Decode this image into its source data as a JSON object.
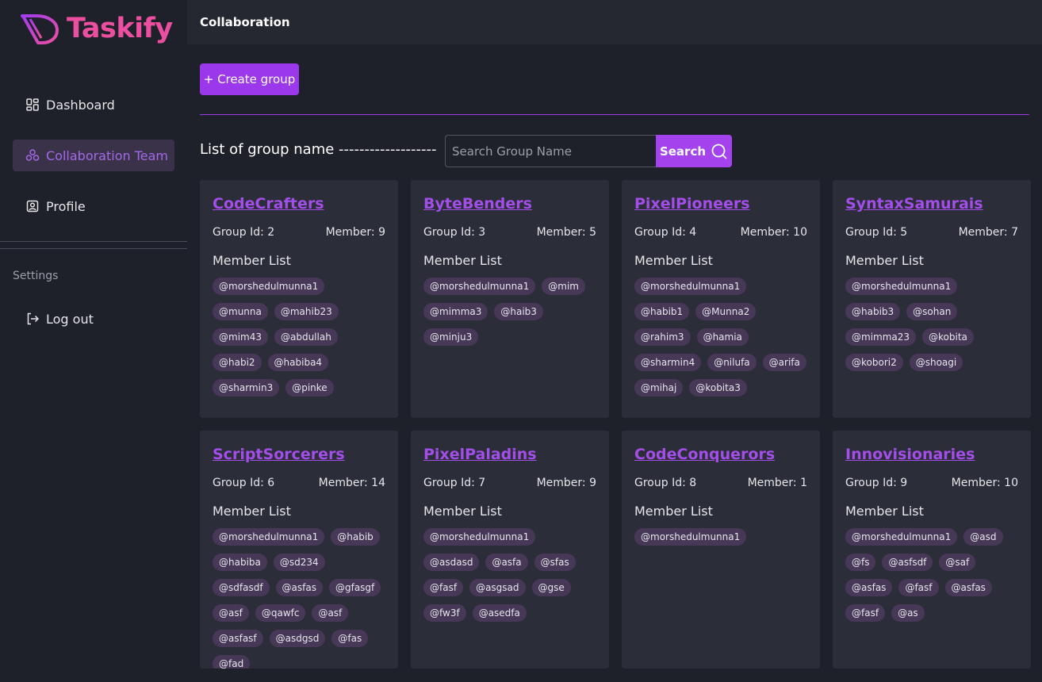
{
  "brand": {
    "name": "Taskify",
    "color": "#ec4fa0",
    "accent": "#9b38ec"
  },
  "sidebar": {
    "items": [
      {
        "label": "Dashboard",
        "icon": "dashboard-icon"
      },
      {
        "label": "Collaboration Team",
        "icon": "team-icon",
        "active": true
      },
      {
        "label": "Profile",
        "icon": "profile-icon"
      }
    ],
    "settings_label": "Settings",
    "logout_label": "Log out"
  },
  "header": {
    "title": "Collaboration"
  },
  "toolbar": {
    "create_label": "+ Create group"
  },
  "list": {
    "title": "List of group name -------------------",
    "search_placeholder": "Search Group Name",
    "search_label": "Search"
  },
  "groups": [
    {
      "name": "CodeCrafters",
      "id_text": "Group Id: 2",
      "member_text": "Member: 9",
      "member_list_label": "Member List",
      "members": [
        "@morshedulmunna1",
        "@munna",
        "@mahib23",
        "@mim43",
        "@abdullah",
        "@habi2",
        "@habiba4",
        "@sharmin3",
        "@pinke"
      ]
    },
    {
      "name": "ByteBenders",
      "id_text": "Group Id: 3",
      "member_text": "Member: 5",
      "member_list_label": "Member List",
      "members": [
        "@morshedulmunna1",
        "@mim",
        "@mimma3",
        "@haib3",
        "@minju3"
      ]
    },
    {
      "name": "PixelPioneers",
      "id_text": "Group Id: 4",
      "member_text": "Member: 10",
      "member_list_label": "Member List",
      "members": [
        "@morshedulmunna1",
        "@habib1",
        "@Munna2",
        "@rahim3",
        "@hamia",
        "@sharmin4",
        "@nilufa",
        "@arifa",
        "@mihaj",
        "@kobita3"
      ]
    },
    {
      "name": "SyntaxSamurais",
      "id_text": "Group Id: 5",
      "member_text": "Member: 7",
      "member_list_label": "Member List",
      "members": [
        "@morshedulmunna1",
        "@habib3",
        "@sohan",
        "@mimma23",
        "@kobita",
        "@kobori2",
        "@shoagi"
      ]
    },
    {
      "name": "ScriptSorcerers",
      "id_text": "Group Id: 6",
      "member_text": "Member: 14",
      "member_list_label": "Member List",
      "members": [
        "@morshedulmunna1",
        "@habib",
        "@habiba",
        "@sd234",
        "@sdfasdf",
        "@asfas",
        "@gfasgf",
        "@asf",
        "@qawfc",
        "@asf",
        "@asfasf",
        "@asdgsd",
        "@fas",
        "@fad"
      ]
    },
    {
      "name": "PixelPaladins",
      "id_text": "Group Id: 7",
      "member_text": "Member: 9",
      "member_list_label": "Member List",
      "members": [
        "@morshedulmunna1",
        "@asdasd",
        "@asfa",
        "@sfas",
        "@fasf",
        "@asgsad",
        "@gse",
        "@fw3f",
        "@asedfa"
      ]
    },
    {
      "name": "CodeConquerors",
      "id_text": "Group Id: 8",
      "member_text": "Member: 1",
      "member_list_label": "Member List",
      "members": [
        "@morshedulmunna1"
      ]
    },
    {
      "name": "Innovisionaries",
      "id_text": "Group Id: 9",
      "member_text": "Member: 10",
      "member_list_label": "Member List",
      "members": [
        "@morshedulmunna1",
        "@asd",
        "@fs",
        "@asfsdf",
        "@saf",
        "@asfas",
        "@fasf",
        "@asfas",
        "@fasf",
        "@as"
      ]
    }
  ]
}
